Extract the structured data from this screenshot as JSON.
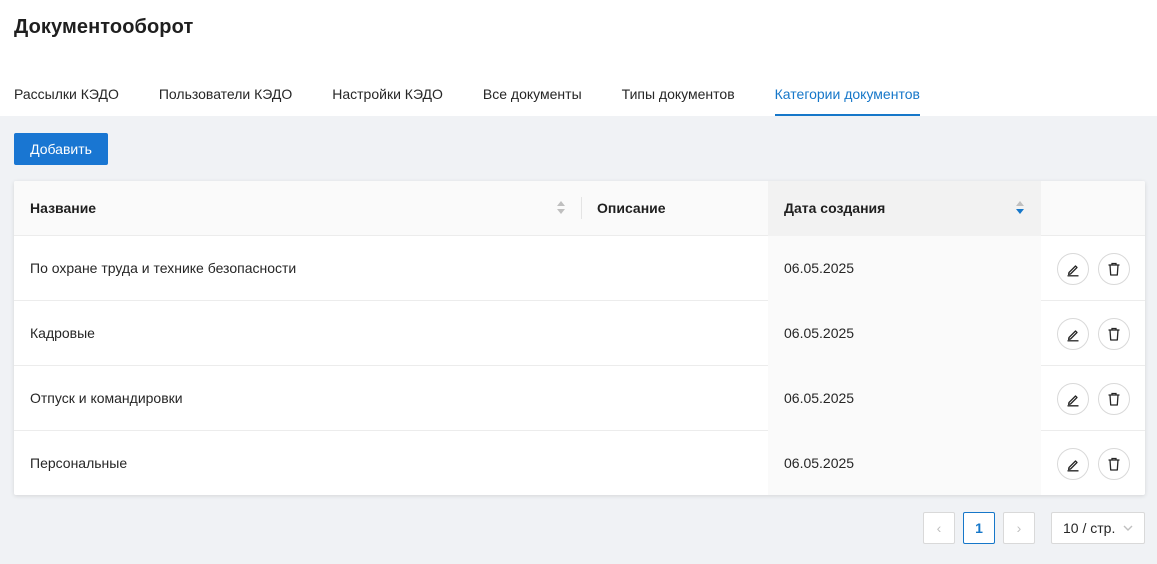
{
  "header": {
    "title": "Документооборот",
    "tabs": [
      {
        "label": "Рассылки КЭДО"
      },
      {
        "label": "Пользователи КЭДО"
      },
      {
        "label": "Настройки КЭДО"
      },
      {
        "label": "Все документы"
      },
      {
        "label": "Типы документов"
      },
      {
        "label": "Категории документов",
        "active": true
      }
    ]
  },
  "toolbar": {
    "add_label": "Добавить"
  },
  "table": {
    "columns": {
      "name": "Название",
      "description": "Описание",
      "created": "Дата создания"
    },
    "rows": [
      {
        "name": "По охране труда и технике безопасности",
        "description": "",
        "created": "06.05.2025"
      },
      {
        "name": "Кадровые",
        "description": "",
        "created": "06.05.2025"
      },
      {
        "name": "Отпуск и командировки",
        "description": "",
        "created": "06.05.2025"
      },
      {
        "name": "Персональные",
        "description": "",
        "created": "06.05.2025"
      }
    ],
    "row_actions": [
      "edit-icon",
      "delete-icon"
    ],
    "sort": {
      "column": "created",
      "direction": "desc"
    }
  },
  "pagination": {
    "prev": "‹",
    "current": "1",
    "next": "›",
    "page_size": "10 / стр."
  },
  "colors": {
    "accent": "#1677c9",
    "button": "#1976d2",
    "background": "#f0f2f5"
  }
}
